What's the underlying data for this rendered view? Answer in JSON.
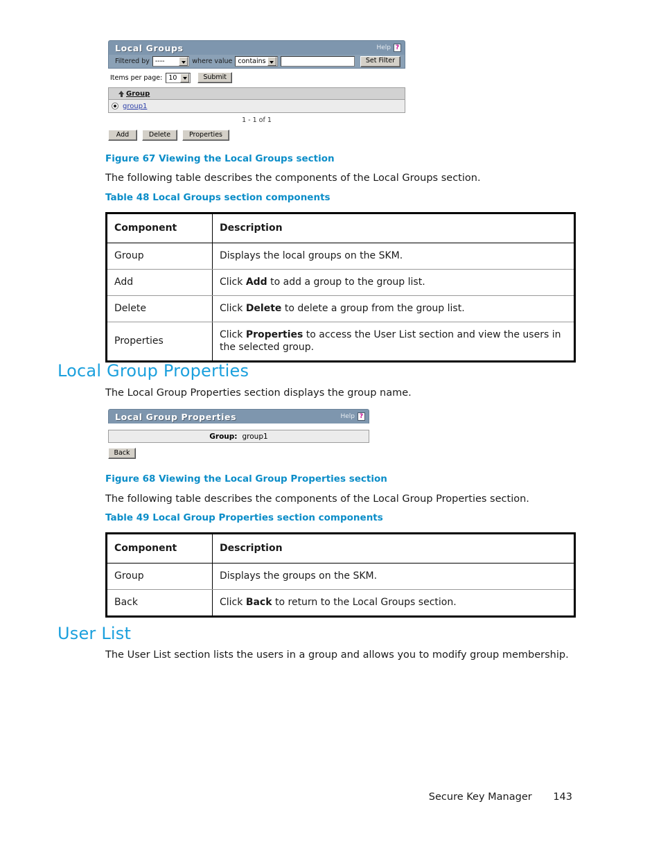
{
  "figure67": {
    "panel_title": "Local Groups",
    "help_label": "Help",
    "help_icon": "question-mark-icon",
    "filter": {
      "filtered_by_label": "Filtered by",
      "filtered_by_value": "----",
      "where_value_label": "where value",
      "operator_value": "contains",
      "filter_text_value": "",
      "filter_text_placeholder": "",
      "set_filter_label": "Set Filter"
    },
    "paging": {
      "items_per_page_label": "Items per page:",
      "items_per_page_value": "10",
      "submit_label": "Submit",
      "range_text": "1 - 1 of 1"
    },
    "grid": {
      "sort_icon": "sort-ascending-icon",
      "column_header": "Group",
      "rows": [
        {
          "selected": true,
          "name": "group1"
        }
      ]
    },
    "buttons": {
      "add_label": "Add",
      "delete_label": "Delete",
      "properties_label": "Properties"
    }
  },
  "fig67_caption": "Figure 67 Viewing the Local Groups section",
  "intro_48": "The following table describes the components of the Local Groups section.",
  "table48_caption": "Table 48 Local Groups section components",
  "table48": {
    "headers": [
      "Component",
      "Description"
    ],
    "rows": [
      {
        "component": "Group",
        "desc_pre": "Displays the local groups on the SKM.",
        "desc_bold": "",
        "desc_post": ""
      },
      {
        "component": "Add",
        "desc_pre": "Click ",
        "desc_bold": "Add",
        "desc_post": " to add a group to the group list."
      },
      {
        "component": "Delete",
        "desc_pre": "Click ",
        "desc_bold": "Delete",
        "desc_post": " to delete a group from the group list."
      },
      {
        "component": "Properties",
        "desc_pre": "Click ",
        "desc_bold": "Properties",
        "desc_post": " to access the User List section and view the users in the selected group."
      }
    ]
  },
  "section_local_group_properties": "Local Group Properties",
  "intro_lgp": "The Local Group Properties section displays the group name.",
  "figure68": {
    "panel_title": "Local Group Properties",
    "help_label": "Help",
    "help_icon": "question-mark-icon",
    "group_key": "Group:",
    "group_value": "group1",
    "back_label": "Back"
  },
  "fig68_caption": "Figure 68 Viewing the Local Group Properties section",
  "intro_49": "The following table describes the components of the Local Group Properties section.",
  "table49_caption": "Table 49 Local Group Properties section components",
  "table49": {
    "headers": [
      "Component",
      "Description"
    ],
    "rows": [
      {
        "component": "Group",
        "desc_pre": "Displays the groups on the SKM.",
        "desc_bold": "",
        "desc_post": ""
      },
      {
        "component": "Back",
        "desc_pre": "Click ",
        "desc_bold": "Back",
        "desc_post": " to return to the Local Groups section."
      }
    ]
  },
  "section_user_list": "User List",
  "intro_user_list": "The User List section lists the users in a group and allows you to modify group membership.",
  "footer": {
    "product": "Secure Key Manager",
    "page_number": "143"
  },
  "colors": {
    "heading_blue": "#1ba0dd",
    "caption_blue": "#0b8dc8",
    "panel_header_blue": "#7e96ae",
    "filter_bar_blue": "#8ba1b6",
    "help_icon_magenta": "#c4008f",
    "link_blue": "#2b3ea8",
    "button_face": "#d4d0c8"
  }
}
